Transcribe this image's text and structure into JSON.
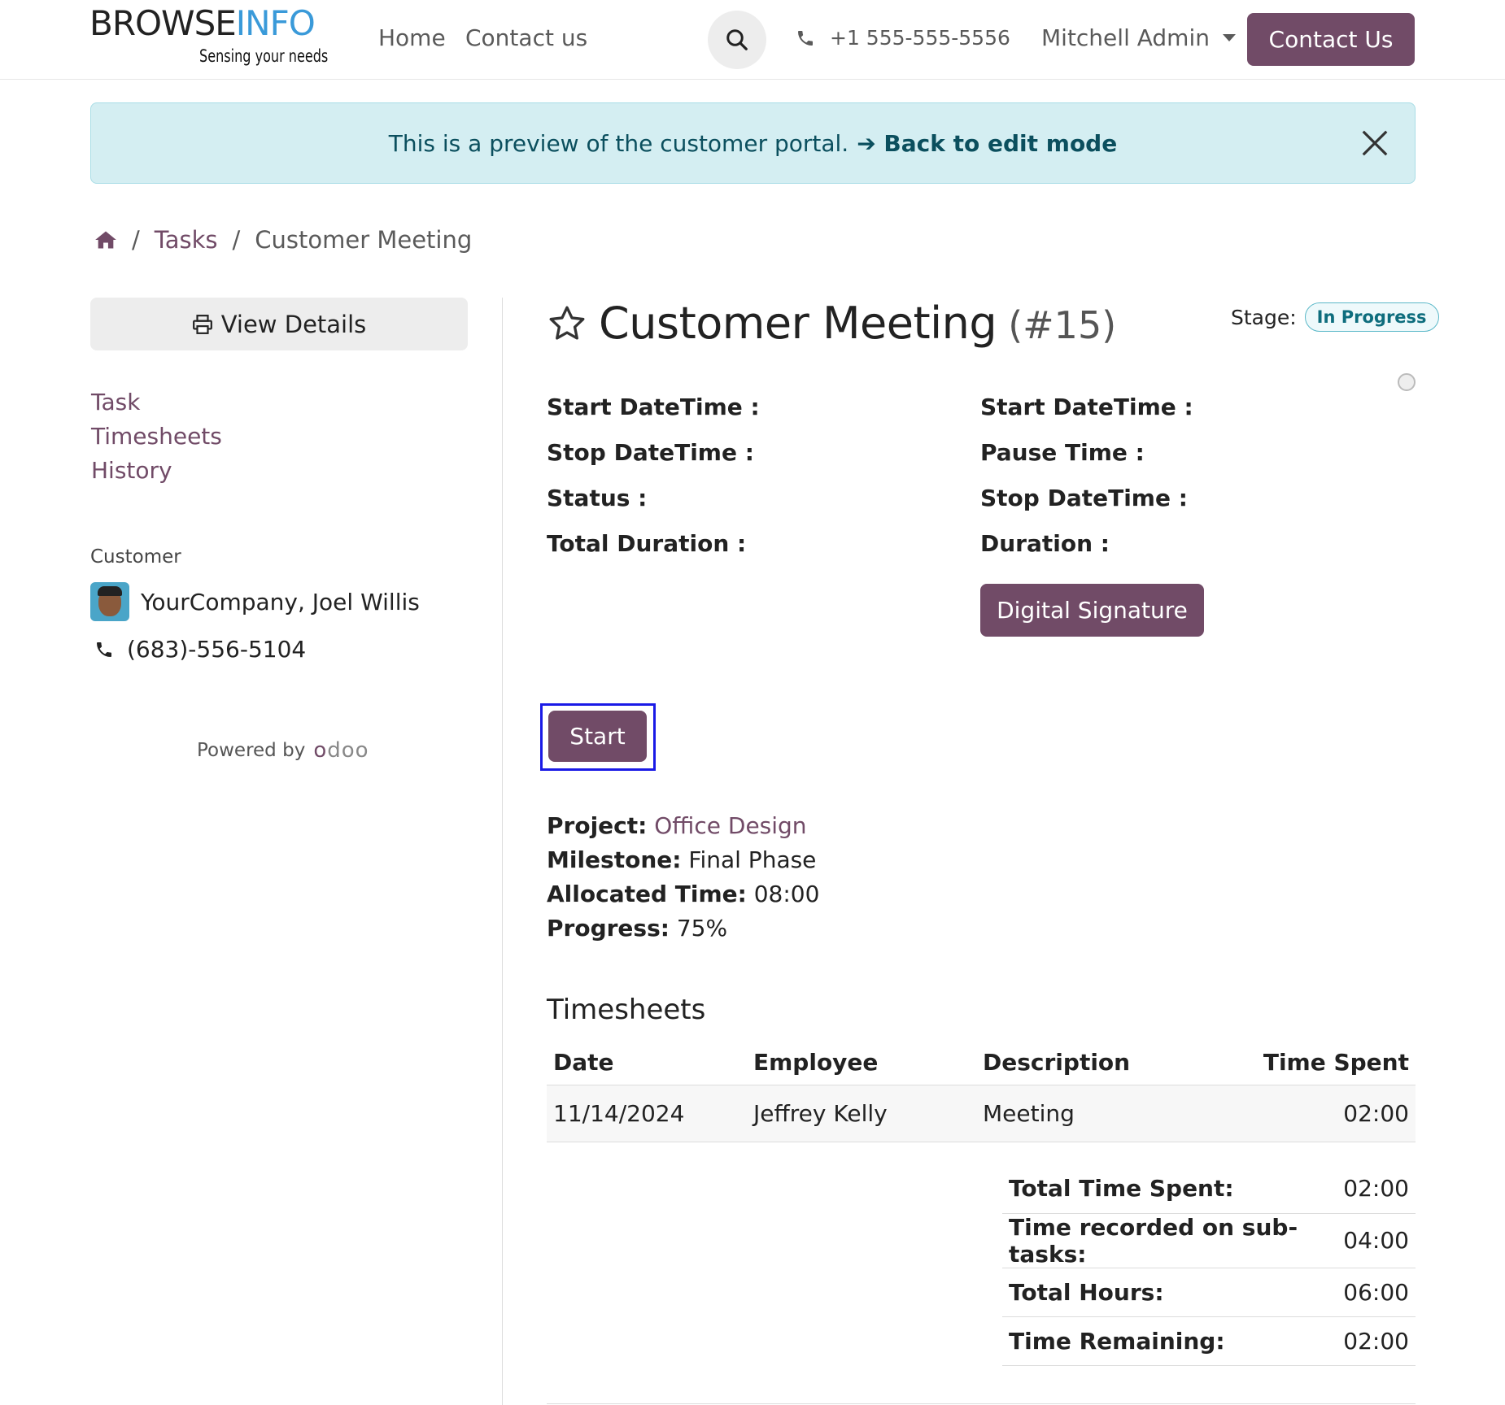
{
  "brand": {
    "name_a": "BROWSE",
    "name_b": "INFO",
    "tagline": "Sensing your needs",
    "accent": "#714B67",
    "logo_blue": "#3a9ad9"
  },
  "nav": {
    "home": "Home",
    "contact": "Contact us",
    "phone": "+1 555-555-5556",
    "user": "Mitchell Admin",
    "cta": "Contact Us"
  },
  "alert": {
    "text": "This is a preview of the customer portal.",
    "link": "➔ Back to edit mode"
  },
  "breadcrumb": {
    "tasks": "Tasks",
    "current": "Customer Meeting"
  },
  "sidebar": {
    "view_details": "View Details",
    "links": [
      "Task",
      "Timesheets",
      "History"
    ],
    "customer_label": "Customer",
    "customer_name": "YourCompany, Joel Willis",
    "customer_phone": "(683)-556-5104",
    "powered_by": "Powered by",
    "powered_brand_a": "o",
    "powered_brand_b": "doo"
  },
  "task": {
    "title": "Customer Meeting",
    "number": "(#15)",
    "stage_label": "Stage:",
    "stage": "In Progress",
    "left_fields": [
      "Start DateTime :",
      "Stop DateTime :",
      "Status :",
      "Total Duration :"
    ],
    "right_fields": [
      "Start DateTime :",
      "Pause Time :",
      "Stop DateTime :",
      "Duration :"
    ],
    "signature_button": "Digital Signature",
    "start_button": "Start",
    "project_label": "Project:",
    "project": "Office Design",
    "milestone_label": "Milestone:",
    "milestone": "Final Phase",
    "allocated_label": "Allocated Time:",
    "allocated": "08:00",
    "progress_label": "Progress:",
    "progress": "75%"
  },
  "timesheets": {
    "title": "Timesheets",
    "headers": [
      "Date",
      "Employee",
      "Description",
      "Time Spent"
    ],
    "rows": [
      [
        "11/14/2024",
        "Jeffrey Kelly",
        "Meeting",
        "02:00"
      ]
    ],
    "totals": [
      [
        "Total Time Spent:",
        "02:00"
      ],
      [
        "Time recorded on sub-tasks:",
        "04:00"
      ],
      [
        "Total Hours:",
        "06:00"
      ],
      [
        "Time Remaining:",
        "02:00"
      ]
    ]
  }
}
